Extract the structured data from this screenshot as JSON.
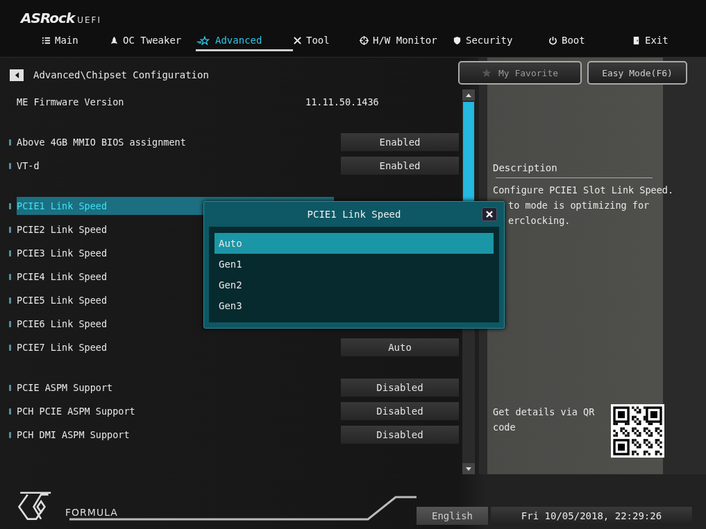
{
  "brand": {
    "name": "ASRock",
    "suffix": "UEFI"
  },
  "tabs": [
    {
      "label": "Main",
      "selected": false
    },
    {
      "label": "OC Tweaker",
      "selected": false
    },
    {
      "label": "Advanced",
      "selected": true
    },
    {
      "label": "Tool",
      "selected": false
    },
    {
      "label": "H/W Monitor",
      "selected": false
    },
    {
      "label": "Security",
      "selected": false
    },
    {
      "label": "Boot",
      "selected": false
    },
    {
      "label": "Exit",
      "selected": false
    }
  ],
  "breadcrumb": "Advanced\\Chipset Configuration",
  "buttons": {
    "favorite": "My Favorite",
    "easy_mode": "Easy Mode(F6)"
  },
  "groups": [
    [
      {
        "kind": "info",
        "label": "ME Firmware Version",
        "value": "11.11.50.1436"
      }
    ],
    [
      {
        "kind": "setting",
        "label": "Above 4GB MMIO BIOS assignment",
        "value": "Enabled",
        "selected": false
      },
      {
        "kind": "setting",
        "label": "VT-d",
        "value": "Enabled",
        "selected": false
      }
    ],
    [
      {
        "kind": "setting",
        "label": "PCIE1 Link Speed",
        "selected": true
      },
      {
        "kind": "setting",
        "label": "PCIE2 Link Speed",
        "selected": false
      },
      {
        "kind": "setting",
        "label": "PCIE3 Link Speed",
        "selected": false
      },
      {
        "kind": "setting",
        "label": "PCIE4 Link Speed",
        "selected": false
      },
      {
        "kind": "setting",
        "label": "PCIE5 Link Speed",
        "selected": false
      },
      {
        "kind": "setting",
        "label": "PCIE6 Link Speed",
        "selected": false
      },
      {
        "kind": "setting",
        "label": "PCIE7 Link Speed",
        "value": "Auto",
        "selected": false
      }
    ],
    [
      {
        "kind": "setting",
        "label": "PCIE ASPM Support",
        "value": "Disabled",
        "selected": false
      },
      {
        "kind": "setting",
        "label": "PCH PCIE ASPM Support",
        "value": "Disabled",
        "selected": false
      },
      {
        "kind": "setting",
        "label": "PCH DMI ASPM Support",
        "value": "Disabled",
        "selected": false
      }
    ]
  ],
  "popup": {
    "title": "PCIE1 Link Speed",
    "options": [
      {
        "label": "Auto",
        "selected": true
      },
      {
        "label": "Gen1",
        "selected": false
      },
      {
        "label": "Gen2",
        "selected": false
      },
      {
        "label": "Gen3",
        "selected": false
      }
    ]
  },
  "description": {
    "title": "Description",
    "lines": [
      "Configure PCIE1 Slot Link Speed.",
      "to mode is optimizing for",
      "erclocking."
    ]
  },
  "qr_text": "Get details via QR code",
  "footer": {
    "logo": "FORMULA",
    "language": "English",
    "datetime": "Fri 10/05/2018, 22:29:26"
  }
}
